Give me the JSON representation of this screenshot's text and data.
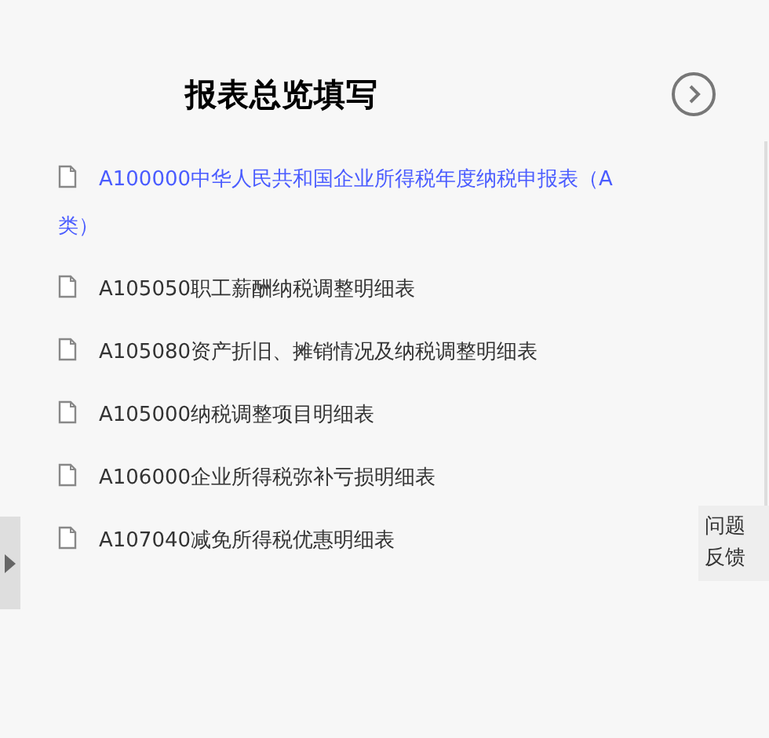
{
  "header": {
    "title": "报表总览填写"
  },
  "reports": [
    {
      "label": "A100000中华人民共和国企业所得税年度纳税申报表（A类）",
      "selected": true
    },
    {
      "label": "A105050职工薪酬纳税调整明细表",
      "selected": false
    },
    {
      "label": "A105080资产折旧、摊销情况及纳税调整明细表",
      "selected": false
    },
    {
      "label": "A105000纳税调整项目明细表",
      "selected": false
    },
    {
      "label": "A106000企业所得税弥补亏损明细表",
      "selected": false
    },
    {
      "label": "A107040减免所得税优惠明细表",
      "selected": false
    }
  ],
  "feedback": {
    "label": "问题反馈"
  }
}
